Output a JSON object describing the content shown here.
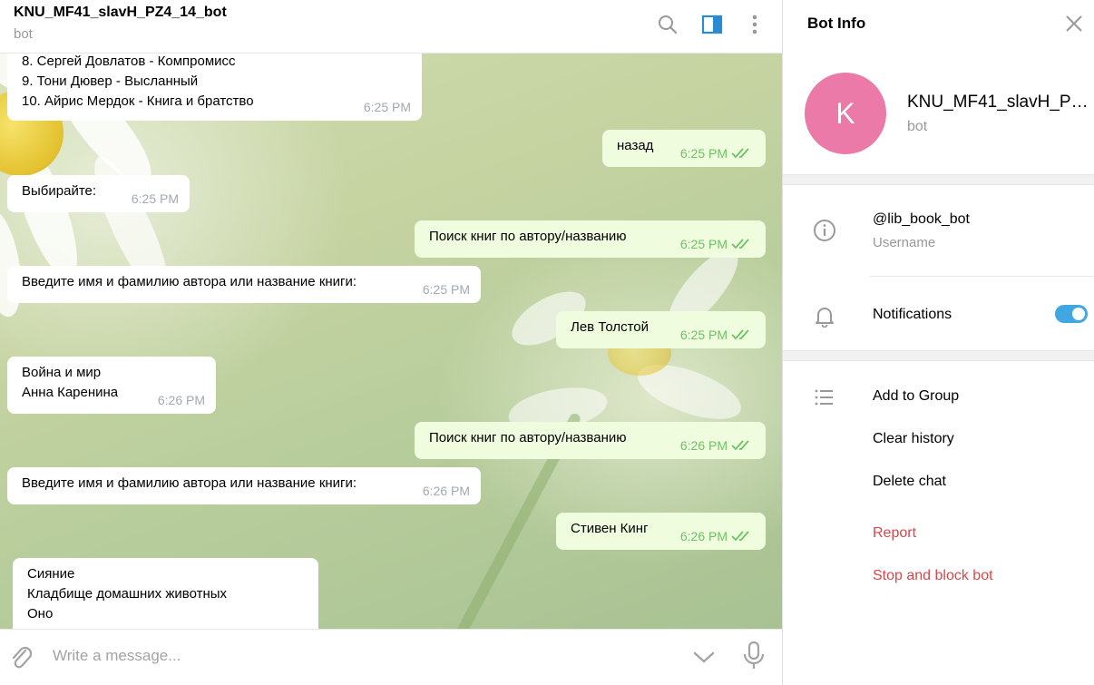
{
  "chat": {
    "title": "KNU_MF41_slavH_PZ4_14_bot",
    "subtitle": "bot",
    "messages": [
      {
        "dir": "in",
        "text": "8. Сергей Довлатов - Компромисс\n9. Тони Дювер - Высланный\n10. Айрис Мердок - Книга и братство",
        "time": "6:25 PM"
      },
      {
        "dir": "out",
        "text": "назад",
        "time": "6:25 PM"
      },
      {
        "dir": "in",
        "text": "Выбирайте:",
        "time": "6:25 PM"
      },
      {
        "dir": "out",
        "text": "Поиск книг по автору/названию",
        "time": "6:25 PM"
      },
      {
        "dir": "in",
        "text": "Введите имя и фамилию автора или название книги:",
        "time": "6:25 PM"
      },
      {
        "dir": "out",
        "text": "Лев Толстой",
        "time": "6:25 PM"
      },
      {
        "dir": "in",
        "text": "Война и мир\nАнна Каренина",
        "time": "6:26 PM"
      },
      {
        "dir": "out",
        "text": "Поиск книг по автору/названию",
        "time": "6:26 PM"
      },
      {
        "dir": "in",
        "text": "Введите имя и фамилию автора или название книги:",
        "time": "6:26 PM"
      },
      {
        "dir": "out",
        "text": "Стивен Кинг",
        "time": "6:26 PM"
      },
      {
        "dir": "in",
        "text": "Сияние\nКладбище домашних животных\nОно",
        "time": ""
      }
    ],
    "composer": {
      "placeholder": "Write a message..."
    }
  },
  "info": {
    "title": "Bot Info",
    "avatar_letter": "K",
    "avatar_color": "#ec7aa8",
    "name": "KNU_MF41_slavH_PZ4_14_bot",
    "status": "bot",
    "username": "@lib_book_bot",
    "username_label": "Username",
    "notifications_label": "Notifications",
    "notifications_on": true,
    "actions": {
      "add_to_group": "Add to Group",
      "clear_history": "Clear history",
      "delete_chat": "Delete chat",
      "report": "Report",
      "stop_and_block": "Stop and block bot"
    }
  },
  "colors": {
    "accent": "#40a7e3",
    "danger": "#d7474d",
    "outgoing_bubble": "#effdde",
    "read_ticks": "#6cc264"
  }
}
